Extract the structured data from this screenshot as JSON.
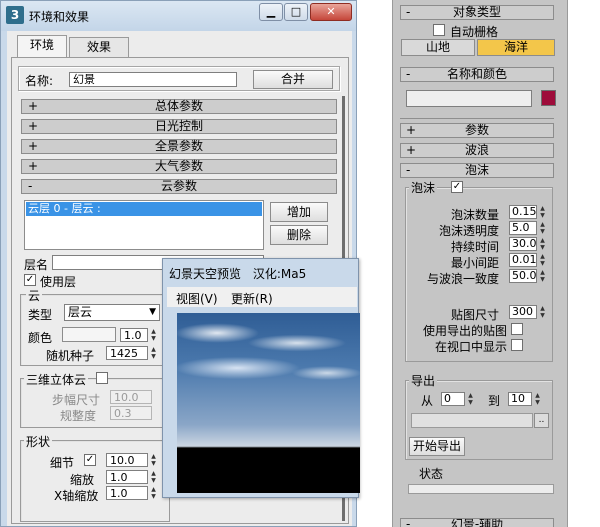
{
  "env_window": {
    "title": "环境和效果",
    "app_icon": "3ds-max-icon",
    "buttons": {
      "minimize": "▁",
      "maximize": "□",
      "close": "✕"
    },
    "tabs": [
      {
        "label": "环境"
      },
      {
        "label": "效果"
      }
    ],
    "name_label": "名称:",
    "name_value": "幻景",
    "merge_label": "合并",
    "rollouts": [
      {
        "sign": "+",
        "label": "总体参数"
      },
      {
        "sign": "+",
        "label": "日光控制"
      },
      {
        "sign": "+",
        "label": "全景参数"
      },
      {
        "sign": "+",
        "label": "大气参数"
      },
      {
        "sign": "-",
        "label": "云参数"
      }
    ],
    "cloud_params": {
      "list_items": [
        "云层 0 - 层云 :"
      ],
      "add_label": "增加",
      "delete_label": "删除",
      "layer_name_label": "层名",
      "use_layer_label": "使用层",
      "use_layer_checked": "✓",
      "cloud_group_label": "云",
      "type_label": "类型",
      "type_value": "层云",
      "color_label": "颜色",
      "color_amount": "1.0",
      "seed_label": "随机种子",
      "seed_value": "1425",
      "volumetric_label": "三维立体云",
      "step_label": "步幅尺寸",
      "step_value": "10.0",
      "regularity_label": "规整度",
      "regularity_value": "0.3",
      "shape_label": "形状",
      "detail_label": "细节",
      "detail_checked": "✓",
      "detail_value": "10.0",
      "scale_label": "缩放",
      "scale_value": "1.0",
      "xscale_label": "X轴缩放",
      "xscale_value": "1.0"
    }
  },
  "preview_window": {
    "title": "幻景天空预览",
    "credit": "汉化:Ma5",
    "menu": [
      "视图(V)",
      "更新(R)"
    ]
  },
  "command_panel": {
    "object_type": {
      "header": "对象类型",
      "auto_grid_label": "自动栅格",
      "buttons": [
        "山地",
        "海洋"
      ],
      "active_color": "#f3c64a"
    },
    "name_color": {
      "header": "名称和颜色",
      "name_value": "",
      "swatch_color": "#9e0c3a"
    },
    "collapsed_rollouts": [
      "参数",
      "波浪"
    ],
    "foam": {
      "header": "泡沫",
      "group_label": "泡沫",
      "group_checked": "✓",
      "params": [
        {
          "label": "泡沫数量",
          "value": "0.15"
        },
        {
          "label": "泡沫透明度",
          "value": "5.0"
        },
        {
          "label": "持续时间",
          "value": "30.0"
        },
        {
          "label": "最小间距",
          "value": "0.01"
        },
        {
          "label": "与波浪一致度",
          "value": "50.0"
        }
      ],
      "map_size_label": "贴图尺寸",
      "map_size_value": "300",
      "use_exported_label": "使用导出的贴图",
      "show_viewport_label": "在视口中显示"
    },
    "export": {
      "group_label": "导出",
      "from_label": "从",
      "from_value": "0",
      "to_label": "到",
      "to_value": "10",
      "browse_label": "..",
      "start_label": "开始导出",
      "status_label": "状态",
      "progress": 0
    },
    "bottom_rollout": "幻景-辅助"
  }
}
